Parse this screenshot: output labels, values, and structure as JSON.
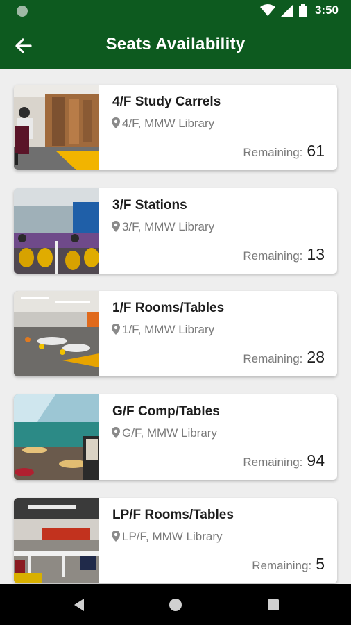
{
  "status_bar": {
    "time": "3:50",
    "icons": [
      "notification-dot-icon",
      "wifi-icon",
      "signal-icon",
      "battery-icon"
    ]
  },
  "app_bar": {
    "title": "Seats Availability",
    "back_icon": "arrow-left-icon",
    "color": "#0d5a1f"
  },
  "cards": [
    {
      "title": "4/F Study Carrels",
      "location": "4/F, MMW Library",
      "remaining_label": "Remaining:",
      "remaining": "61"
    },
    {
      "title": "3/F Stations",
      "location": "3/F, MMW Library",
      "remaining_label": "Remaining:",
      "remaining": "13"
    },
    {
      "title": "1/F Rooms/Tables",
      "location": "1/F, MMW Library",
      "remaining_label": "Remaining:",
      "remaining": "28"
    },
    {
      "title": "G/F Comp/Tables",
      "location": "G/F, MMW Library",
      "remaining_label": "Remaining:",
      "remaining": "94"
    },
    {
      "title": "LP/F Rooms/Tables",
      "location": "LP/F, MMW Library",
      "remaining_label": "Remaining:",
      "remaining": "5"
    }
  ],
  "nav_bar": {
    "icons": [
      "back-triangle-icon",
      "home-circle-icon",
      "recents-square-icon"
    ]
  }
}
